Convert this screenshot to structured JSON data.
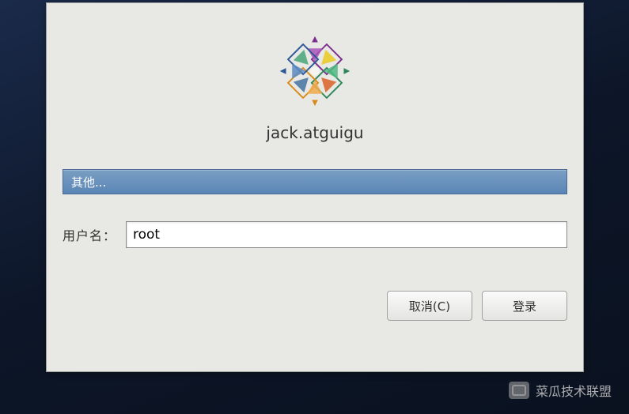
{
  "hostname": "jack.atguigu",
  "user_selector": {
    "selected_label": "其他..."
  },
  "form": {
    "username_label": "用户名：",
    "username_value": "root"
  },
  "buttons": {
    "cancel_label": "取消(C)",
    "login_label": "登录"
  },
  "watermark": {
    "text": "菜瓜技术联盟"
  }
}
